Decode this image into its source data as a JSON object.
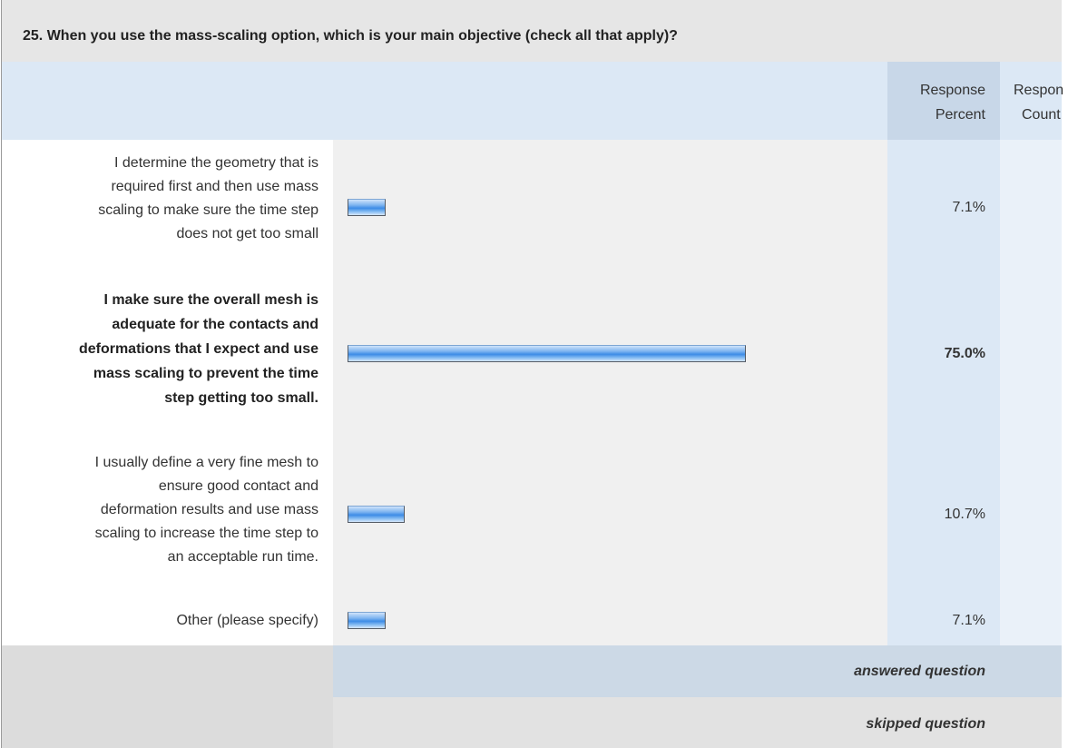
{
  "question": {
    "title": "25. When you use the mass-scaling option, which is your main objective (check all that apply)?"
  },
  "columns": {
    "percent_line1": "Response",
    "percent_line2": "Percent",
    "count_line1": "Response",
    "count_line2": "Count"
  },
  "chart_data": {
    "type": "bar",
    "orientation": "horizontal",
    "categories": [
      "I determine the geometry that is required first and then use mass scaling to make sure the time step does not get too small",
      "I make sure the overall mesh is adequate for the contacts and deformations that I expect and use mass scaling to prevent the time step getting too small.",
      "I usually define a very fine mesh to ensure good contact and deformation results and use mass scaling to increase the time step to an acceptable run time.",
      "Other (please specify)"
    ],
    "values": [
      7.1,
      75.0,
      10.7,
      7.1
    ],
    "xlim": [
      0,
      100
    ],
    "grid": false
  },
  "rows": [
    {
      "label_lines": [
        "I determine the geometry that is",
        "required first and then use mass",
        "scaling to make sure the time step",
        "does not get too small"
      ],
      "percent_text": "7.1%",
      "bold": false
    },
    {
      "label_lines": [
        "I make sure the overall mesh is",
        "adequate for the contacts and",
        "deformations that I expect and use",
        "mass scaling to prevent the time",
        "step getting too small."
      ],
      "percent_text": "75.0%",
      "bold": true
    },
    {
      "label_lines": [
        "I usually define a very fine mesh to",
        "ensure good contact and",
        "deformation results and use mass",
        "scaling to increase the time step to",
        "an acceptable run time."
      ],
      "percent_text": "10.7%",
      "bold": false
    },
    {
      "label_lines": [
        "Other (please specify)"
      ],
      "percent_text": "7.1%",
      "bold": false
    }
  ],
  "footer": {
    "answered": "answered question",
    "skipped": "skipped question"
  },
  "colors": {
    "bar": "#3d8ce6",
    "header_bg": "#dce8f5",
    "percent_column_bg": "#c8d7e8"
  }
}
